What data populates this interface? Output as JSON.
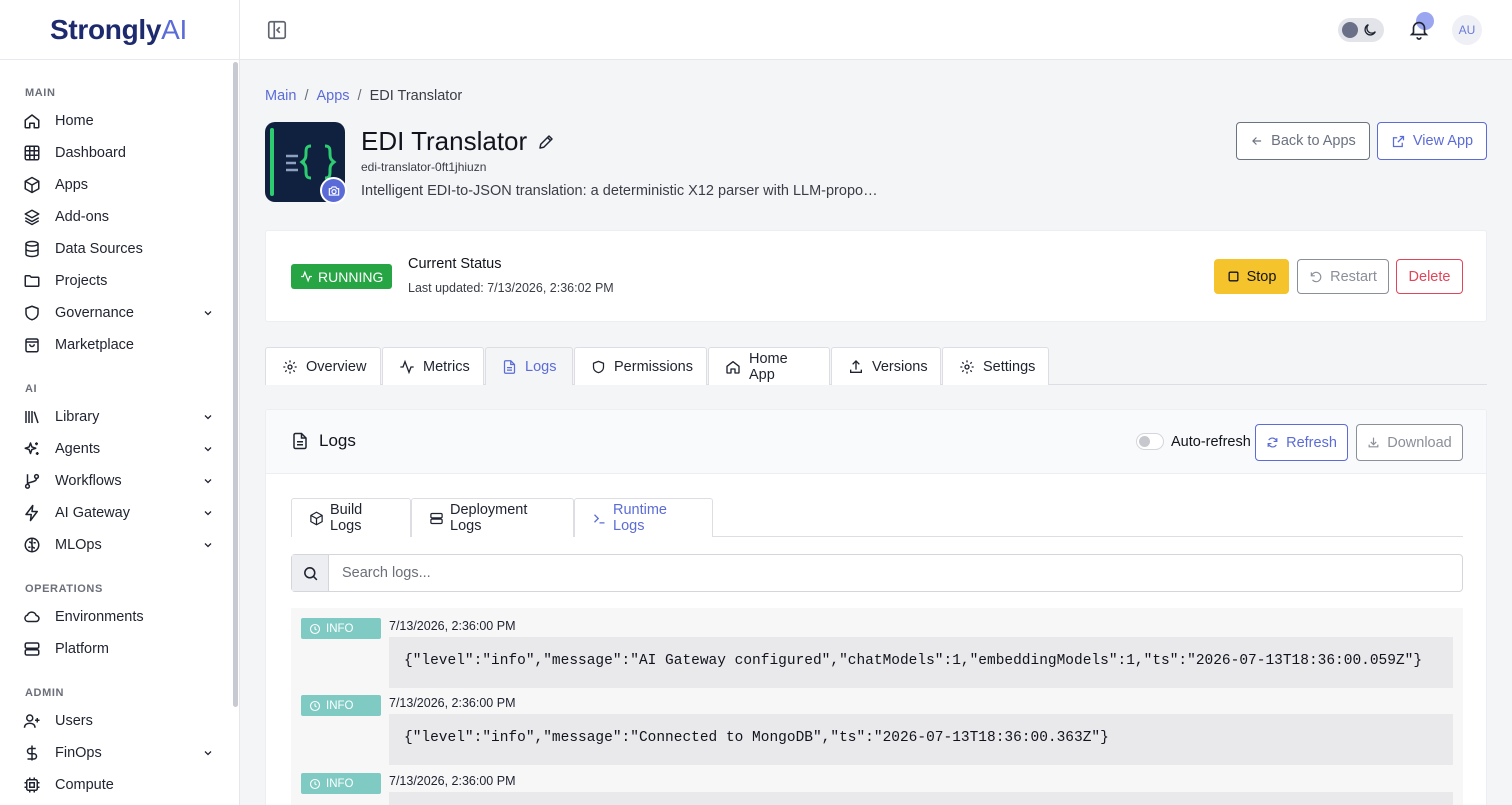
{
  "brand": {
    "name": "Strongly",
    "suffix": "AI"
  },
  "sidebar": {
    "sections": {
      "main": "MAIN",
      "ai": "AI",
      "operations": "OPERATIONS",
      "admin": "ADMIN"
    },
    "items": [
      {
        "label": "Home",
        "icon": "home-icon"
      },
      {
        "label": "Dashboard",
        "icon": "grid-icon"
      },
      {
        "label": "Apps",
        "icon": "box-icon"
      },
      {
        "label": "Add-ons",
        "icon": "layers-icon"
      },
      {
        "label": "Data Sources",
        "icon": "database-icon"
      },
      {
        "label": "Projects",
        "icon": "folder-icon"
      },
      {
        "label": "Governance",
        "icon": "shield-icon"
      },
      {
        "label": "Marketplace",
        "icon": "shopping-bag-icon"
      },
      {
        "label": "Library",
        "icon": "library-icon"
      },
      {
        "label": "Agents",
        "icon": "sparkles-icon"
      },
      {
        "label": "Workflows",
        "icon": "git-branch-icon"
      },
      {
        "label": "AI Gateway",
        "icon": "bolt-icon"
      },
      {
        "label": "MLOps",
        "icon": "brain-icon"
      },
      {
        "label": "Environments",
        "icon": "cloud-icon"
      },
      {
        "label": "Platform",
        "icon": "server-icon"
      },
      {
        "label": "Users",
        "icon": "user-plus-icon"
      },
      {
        "label": "FinOps",
        "icon": "dollar-icon"
      },
      {
        "label": "Compute",
        "icon": "cpu-icon"
      }
    ]
  },
  "header": {
    "avatar": "AU"
  },
  "breadcrumb": {
    "main": "Main",
    "apps": "Apps",
    "current": "EDI Translator"
  },
  "app": {
    "name": "EDI Translator",
    "slug": "edi-translator-0ft1jhiuzn",
    "description": "Intelligent EDI-to-JSON translation: a deterministic X12 parser with LLM-propo…",
    "back_label": "Back to Apps",
    "view_label": "View App"
  },
  "status": {
    "badge": "RUNNING",
    "title": "Current Status",
    "updated": "Last updated: 7/13/2026, 2:36:02 PM",
    "stop": "Stop",
    "restart": "Restart",
    "delete": "Delete"
  },
  "tabs": [
    "Overview",
    "Metrics",
    "Logs",
    "Permissions",
    "Home App",
    "Versions",
    "Settings"
  ],
  "logs": {
    "title": "Logs",
    "auto_refresh": "Auto-refresh",
    "refresh": "Refresh",
    "download": "Download",
    "subtabs": [
      "Build Logs",
      "Deployment Logs",
      "Runtime Logs"
    ],
    "search_placeholder": "Search logs...",
    "entries": [
      {
        "level": "INFO",
        "time": "7/13/2026, 2:36:00 PM",
        "message": "{\"level\":\"info\",\"message\":\"AI Gateway configured\",\"chatModels\":1,\"embeddingModels\":1,\"ts\":\"2026-07-13T18:36:00.059Z\"}"
      },
      {
        "level": "INFO",
        "time": "7/13/2026, 2:36:00 PM",
        "message": "{\"level\":\"info\",\"message\":\"Connected to MongoDB\",\"ts\":\"2026-07-13T18:36:00.363Z\"}"
      },
      {
        "level": "INFO",
        "time": "7/13/2026, 2:36:00 PM",
        "message": ""
      }
    ]
  },
  "colors": {
    "accent": "#5b6cd6",
    "running": "#27a544",
    "stop": "#f5c32c",
    "delete": "#e0455a",
    "info": "#7fcbc4"
  }
}
